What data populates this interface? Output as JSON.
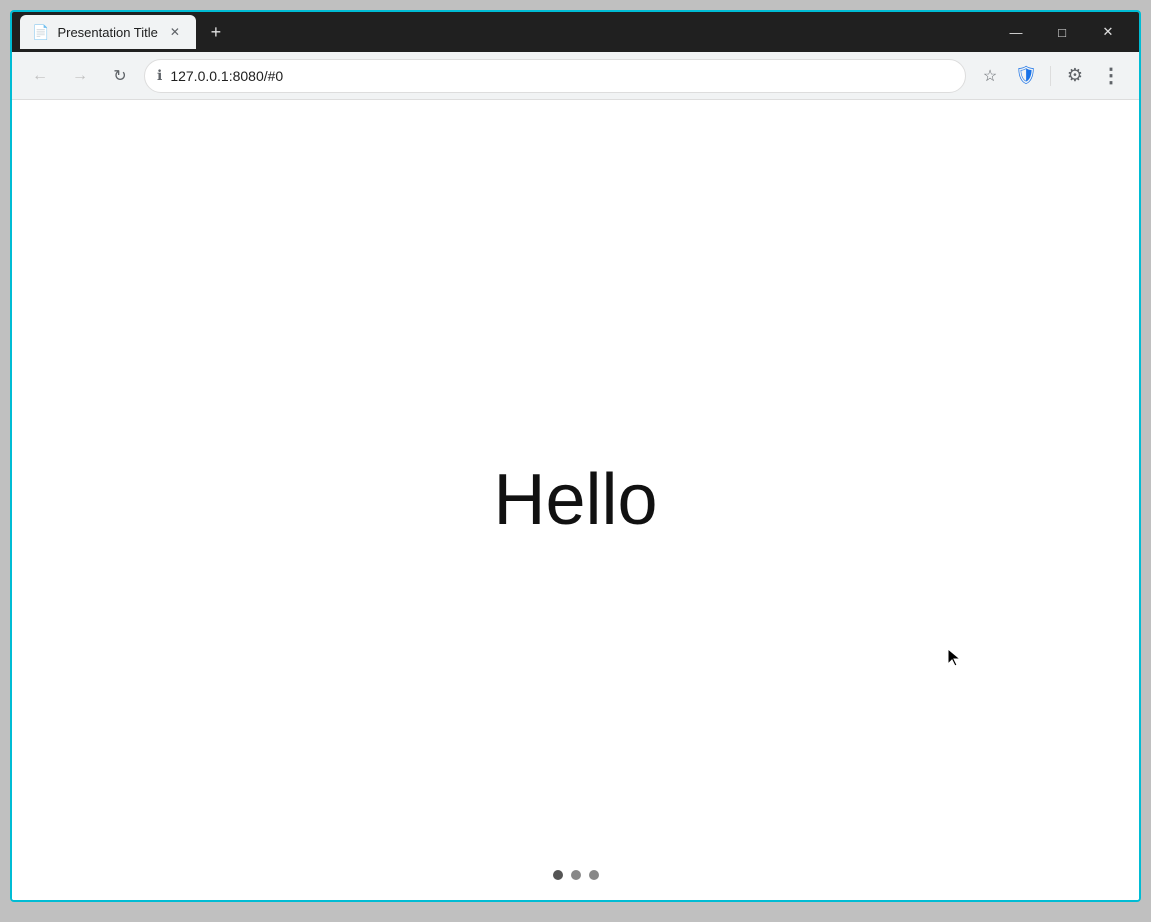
{
  "browser": {
    "title_bar": {
      "tab": {
        "title": "Presentation Title",
        "icon": "📄"
      },
      "new_tab_label": "+",
      "window_controls": {
        "minimize": "—",
        "maximize": "□",
        "close": "✕"
      }
    },
    "nav_bar": {
      "back_label": "←",
      "forward_label": "→",
      "reload_label": "↻",
      "security_icon": "ℹ",
      "url": "127.0.0.1:8080/#0",
      "bookmark_icon": "☆",
      "shield_icon": "🛡",
      "divider": "|",
      "extensions_icon": "⚙",
      "menu_icon": "⋮"
    },
    "page": {
      "slide_text": "Hello",
      "dots": [
        {
          "active": true
        },
        {
          "active": false
        },
        {
          "active": false
        }
      ]
    }
  }
}
